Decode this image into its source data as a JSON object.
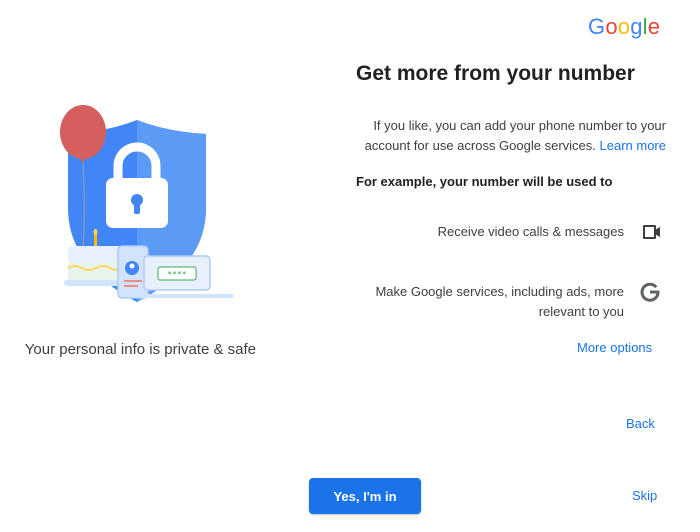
{
  "logo": {
    "letters": [
      {
        "ch": "G",
        "color": "#4285F4"
      },
      {
        "ch": "o",
        "color": "#EA4335"
      },
      {
        "ch": "o",
        "color": "#FBBC05"
      },
      {
        "ch": "g",
        "color": "#4285F4"
      },
      {
        "ch": "l",
        "color": "#34A853"
      },
      {
        "ch": "e",
        "color": "#EA4335"
      }
    ]
  },
  "header": {
    "title": "Get more from your number"
  },
  "intro": {
    "text": "If you like, you can add your phone number to your account for use across Google services.",
    "learn_more": "Learn more"
  },
  "uses": {
    "heading": "For example, your number will be used to",
    "items": [
      {
        "label": "Receive video calls & messages",
        "icon": "video-camera-icon"
      },
      {
        "label": "Make Google services, including ads, more relevant to you",
        "icon": "google-g-icon"
      }
    ]
  },
  "links": {
    "more_options": "More options",
    "back": "Back",
    "skip": "Skip"
  },
  "buttons": {
    "confirm": "Yes, I'm in"
  },
  "illustration": {
    "card_code": "****",
    "caption": "Your personal info is private & safe"
  },
  "colors": {
    "accent": "#1a73e8",
    "shield": "#4285F4",
    "balloon": "#d35f5f"
  }
}
